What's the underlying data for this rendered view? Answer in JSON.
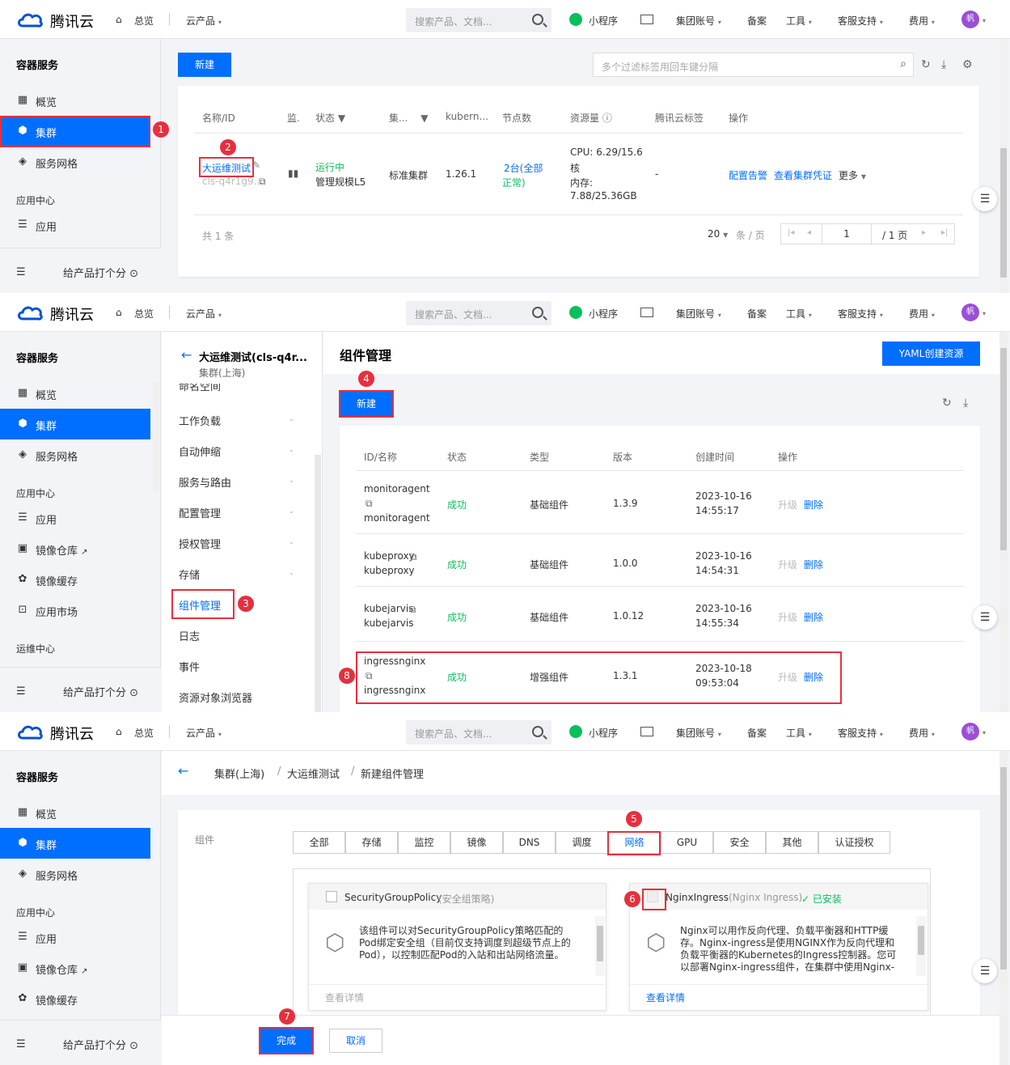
{
  "topbar": {
    "brand": "腾讯云",
    "overview": "总览",
    "products": "云产品",
    "search_placeholder": "搜索产品、文档...",
    "miniapp": "小程序",
    "group_account": "集团账号",
    "beian": "备案",
    "tools": "工具",
    "support": "客服支持",
    "fees": "费用",
    "avatar": "帆"
  },
  "sidebar": {
    "title": "容器服务",
    "overview": "概览",
    "cluster": "集群",
    "mesh": "服务网格",
    "app_center": "应用中心",
    "app": "应用",
    "registry": "镜像仓库",
    "image_cache": "镜像缓存",
    "market": "应用市场",
    "ops_center": "运维中心",
    "feedback": "给产品打个分"
  },
  "step_badges": [
    "1",
    "2",
    "3",
    "4",
    "5",
    "6",
    "7",
    "8"
  ],
  "panel1": {
    "new_button": "新建",
    "filter_placeholder": "多个过滤标签用回车键分隔",
    "headers": [
      "名称/ID",
      "监.",
      "状态",
      "集...",
      "kubern...",
      "节点数",
      "资源量",
      "腾讯云标签",
      "操作"
    ],
    "row": {
      "name": "大运维测试",
      "id": "cls-q4r1g9...",
      "status": "运行中",
      "scale": "管理规模L5",
      "type": "标准集群",
      "version": "1.26.1",
      "nodes_1": "2台(全部",
      "nodes_2": "正常)",
      "cpu_1": "CPU: 6.29/15.6",
      "cpu_2": "核",
      "mem_1": "内存:",
      "mem_2": "7.88/25.36GB",
      "tags": "-",
      "op_alarm": "配置告警",
      "op_cred": "查看集群凭证",
      "op_more": "更多"
    },
    "pager": {
      "total": "共 1 条",
      "page_size": "20",
      "per_page": "条 / 页",
      "page": "1",
      "pages": "/ 1 页"
    }
  },
  "panel2": {
    "cluster_title": "大运维测试(cls-q4r...",
    "cluster_region": "集群(上海)",
    "nav_partial": "命名空间",
    "nav": [
      "工作负载",
      "自动伸缩",
      "服务与路由",
      "配置管理",
      "授权管理",
      "存储",
      "组件管理",
      "日志",
      "事件",
      "资源对象浏览器"
    ],
    "page_title": "组件管理",
    "yaml_button": "YAML创建资源",
    "new_button": "新建",
    "headers": [
      "ID/名称",
      "状态",
      "类型",
      "版本",
      "创建时间",
      "操作"
    ],
    "rows": [
      {
        "id": "monitoragent",
        "name": "monitoragent",
        "status": "成功",
        "type": "基础组件",
        "version": "1.3.9",
        "date": "2023-10-16",
        "time": "14:55:17",
        "upgrade": "升级",
        "delete": "删除"
      },
      {
        "id": "kubeproxy",
        "name": "kubeproxy",
        "status": "成功",
        "type": "基础组件",
        "version": "1.0.0",
        "date": "2023-10-16",
        "time": "14:54:31",
        "upgrade": "升级",
        "delete": "删除"
      },
      {
        "id": "kubejarvis",
        "name": "kubejarvis",
        "status": "成功",
        "type": "基础组件",
        "version": "1.0.12",
        "date": "2023-10-16",
        "time": "14:55:34",
        "upgrade": "升级",
        "delete": "删除"
      },
      {
        "id": "ingressnginx",
        "name": "ingressnginx",
        "status": "成功",
        "type": "增强组件",
        "version": "1.3.1",
        "date": "2023-10-18",
        "time": "09:53:04",
        "upgrade": "升级",
        "delete": "删除"
      }
    ]
  },
  "panel3": {
    "breadcrumb": [
      "集群(上海)",
      "大运维测试",
      "新建组件管理"
    ],
    "section_label": "组件",
    "tabs": [
      "全部",
      "存储",
      "监控",
      "镜像",
      "DNS",
      "调度",
      "网络",
      "GPU",
      "安全",
      "其他",
      "认证授权"
    ],
    "selected_tab": "网络",
    "card1": {
      "title": "SecurityGroupPolicy",
      "subtitle": "(安全组策略)",
      "desc": "该组件可以对SecurityGroupPolicy策略匹配的Pod绑定安全组（目前仅支持调度到超级节点上的Pod），以控制匹配Pod的入站和出站网络流量。",
      "link": "查看详情"
    },
    "card2": {
      "title": "NginxIngress",
      "subtitle": "(Nginx Ingress)",
      "installed": "已安装",
      "desc": "Nginx可以用作反向代理、负载平衡器和HTTP缓存。Nginx-ingress是使用NGINX作为反向代理和负载平衡器的Kubernetes的Ingress控制器。您可以部署Nginx-ingress组件，在集群中使用Nginx-ingress",
      "link": "查看详情"
    },
    "done_button": "完成",
    "cancel_button": "取消"
  }
}
